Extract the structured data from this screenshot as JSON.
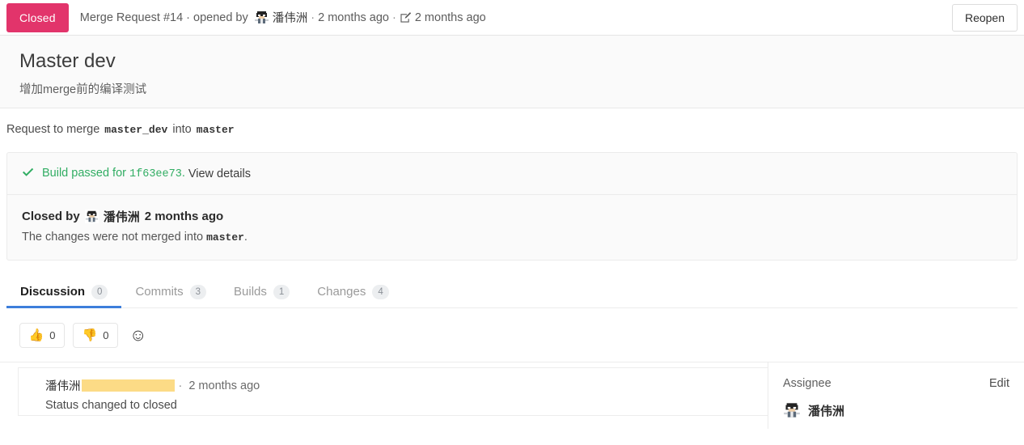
{
  "header": {
    "state_badge": "Closed",
    "meta_prefix": "Merge Request #14 · opened by",
    "author": "潘伟洲",
    "opened_time": "2 months ago",
    "edited_time": "2 months ago",
    "separator": "·",
    "edit_icon": "pencil-square-icon",
    "reopen_label": "Reopen",
    "badge_color": "#e2346b"
  },
  "title_block": {
    "title": "Master dev",
    "description": "增加merge前的编译测试"
  },
  "merge_request_line": {
    "prefix": "Request to merge",
    "source_branch": "master_dev",
    "middle": "into",
    "target_branch": "master"
  },
  "widget": {
    "build": {
      "icon": "check-icon",
      "text": "Build passed for",
      "sha": "1f63ee73",
      "period": ".",
      "link_label": "View details",
      "status_color": "#31ad63"
    },
    "closed": {
      "prefix": "Closed by",
      "author": "潘伟洲",
      "time": "2 months ago",
      "note_prefix": "The changes were not merged into",
      "branch": "master",
      "note_suffix": "."
    }
  },
  "tabs": [
    {
      "label": "Discussion",
      "count": "0",
      "active": true
    },
    {
      "label": "Commits",
      "count": "3",
      "active": false
    },
    {
      "label": "Builds",
      "count": "1",
      "active": false
    },
    {
      "label": "Changes",
      "count": "4",
      "active": false
    }
  ],
  "tab_accent_color": "#3d7edb",
  "awards": [
    {
      "emoji": "👍",
      "name": "thumbsup-icon",
      "count": "0"
    },
    {
      "emoji": "👎",
      "name": "thumbsdown-icon",
      "count": "0"
    }
  ],
  "add_award_icon": "☺",
  "note": {
    "author": "潘伟洲",
    "redacted": true,
    "separator": "·",
    "time": "2 months ago",
    "body": "Status changed to closed"
  },
  "sidebar": {
    "assignee_label": "Assignee",
    "edit_label": "Edit",
    "assignee_name": "潘伟洲"
  }
}
